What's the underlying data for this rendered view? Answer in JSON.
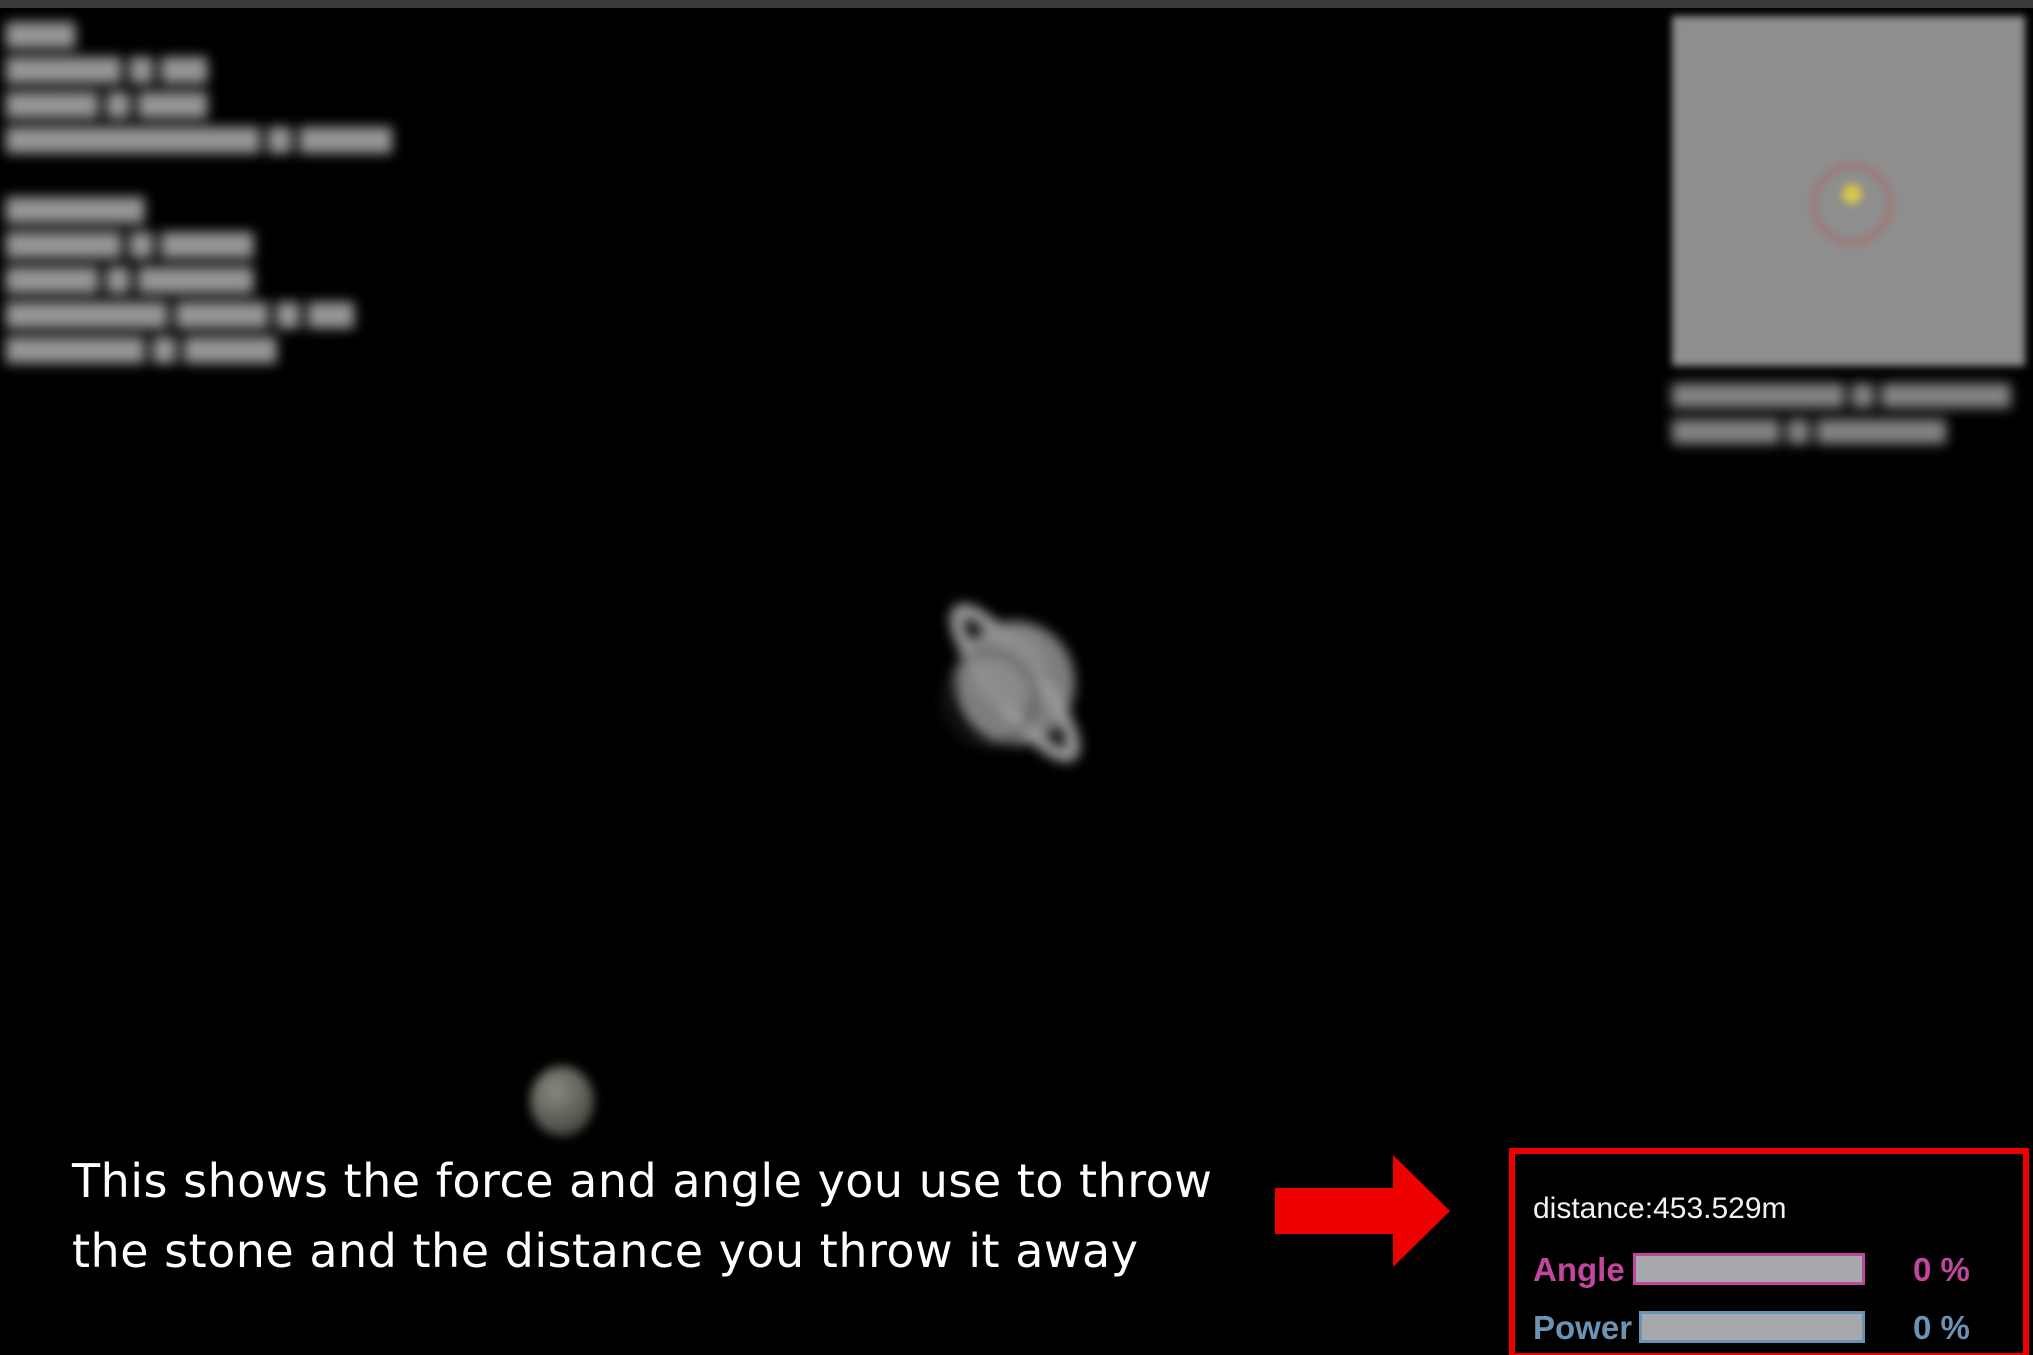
{
  "caption": {
    "line1": "This shows the force and angle you use to throw",
    "line2": "the stone and the distance you throw it away"
  },
  "hud": {
    "distance_text": "distance:453.529m",
    "angle": {
      "label": "Angle",
      "percent_text": "0 %",
      "value": 0
    },
    "power": {
      "label": "Power",
      "percent_text": "0 %",
      "value": 0
    }
  },
  "colors": {
    "highlight_box": "#ee0000",
    "arrow": "#ee0000",
    "angle_accent": "#c2469e",
    "power_accent": "#6b93b4",
    "background": "#000000"
  }
}
